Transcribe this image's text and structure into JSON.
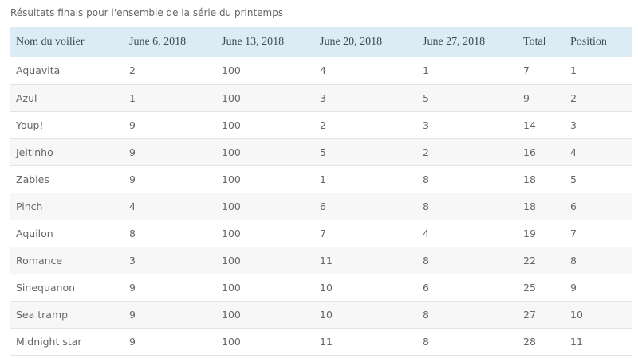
{
  "caption": "Résultats finals pour l'ensemble de la série du printemps",
  "table": {
    "headers": [
      "Nom du voilier",
      "June 6, 2018",
      "June 13, 2018",
      "June 20, 2018",
      "June 27, 2018",
      "Total",
      "Position"
    ],
    "rows": [
      [
        "Aquavita",
        "2",
        "100",
        "4",
        "1",
        "7",
        "1"
      ],
      [
        "Azul",
        "1",
        "100",
        "3",
        "5",
        "9",
        "2"
      ],
      [
        "Youp!",
        "9",
        "100",
        "2",
        "3",
        "14",
        "3"
      ],
      [
        "Jeitinho",
        "9",
        "100",
        "5",
        "2",
        "16",
        "4"
      ],
      [
        "Zabies",
        "9",
        "100",
        "1",
        "8",
        "18",
        "5"
      ],
      [
        "Pinch",
        "4",
        "100",
        "6",
        "8",
        "18",
        "6"
      ],
      [
        "Aquilon",
        "8",
        "100",
        "7",
        "4",
        "19",
        "7"
      ],
      [
        "Romance",
        "3",
        "100",
        "11",
        "8",
        "22",
        "8"
      ],
      [
        "Sinequanon",
        "9",
        "100",
        "10",
        "6",
        "25",
        "9"
      ],
      [
        "Sea tramp",
        "9",
        "100",
        "10",
        "8",
        "27",
        "10"
      ],
      [
        "Midnight star",
        "9",
        "100",
        "11",
        "8",
        "28",
        "11"
      ]
    ]
  },
  "colors": {
    "header_background": "#dcecf5",
    "header_text": "#3e4a55",
    "row_alt_background": "#f7f7f7",
    "body_text": "#666666"
  }
}
